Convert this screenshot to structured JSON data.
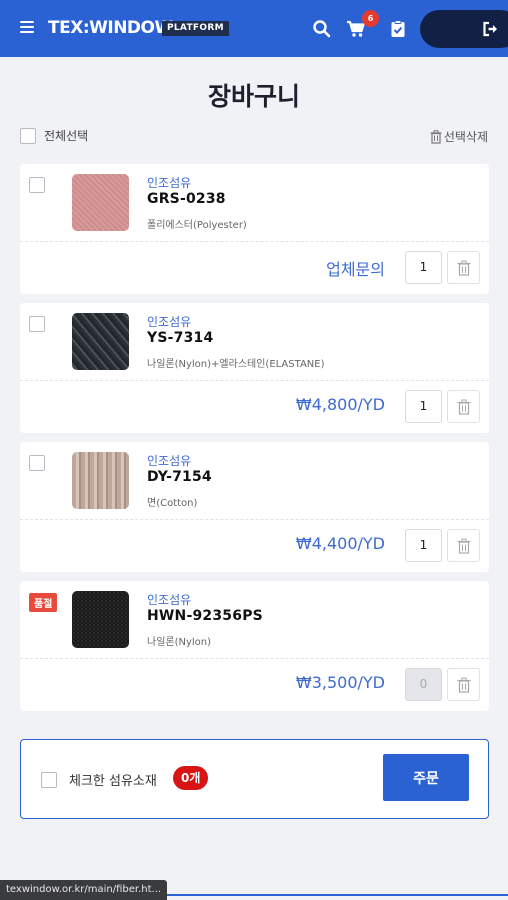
{
  "header": {
    "logo": "TEX:WINDOW",
    "platform_badge": "PLATFORM",
    "cart_count": "6",
    "icons": [
      "menu-icon",
      "search-icon",
      "cart-icon",
      "clipboard-check-icon",
      "logout-icon"
    ]
  },
  "page": {
    "title": "장바구니",
    "select_all": "전체선택",
    "delete_selected": "선택삭제"
  },
  "items": [
    {
      "category": "인조섬유",
      "code": "GRS-0238",
      "material": "폴리에스터(Polyester)",
      "price": "업체문의",
      "qty": "1",
      "sold_out": ""
    },
    {
      "category": "인조섬유",
      "code": "YS-7314",
      "material": "나일론(Nylon)+엘라스테인(ELASTANE)",
      "price": "₩4,800/YD",
      "qty": "1",
      "sold_out": ""
    },
    {
      "category": "인조섬유",
      "code": "DY-7154",
      "material": "면(Cotton)",
      "price": "₩4,400/YD",
      "qty": "1",
      "sold_out": ""
    },
    {
      "category": "인조섬유",
      "code": "HWN-92356PS",
      "material": "나일론(Nylon)",
      "price": "₩3,500/YD",
      "qty": "0",
      "sold_out": "품절"
    }
  ],
  "order": {
    "label": "체크한 섬유소재",
    "count": "0개",
    "button": "주문"
  },
  "status_bar": {
    "url": "texwindow.or.kr/main/fiber.ht..."
  },
  "colors": {
    "brand": "#2a62d3",
    "price": "#3e6bd0",
    "badge_red": "#d81414"
  }
}
